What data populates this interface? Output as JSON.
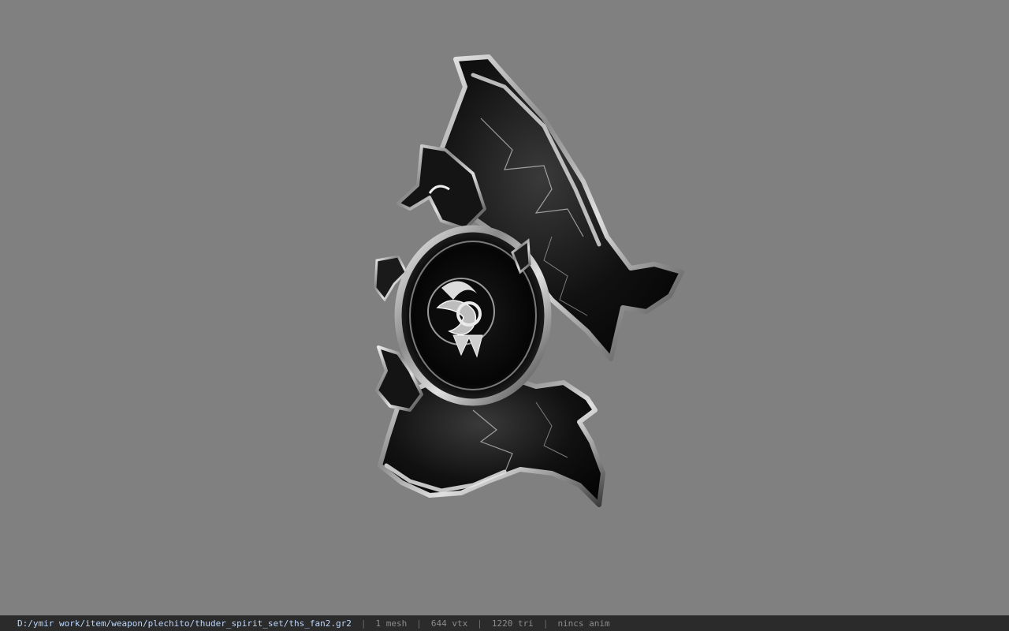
{
  "viewer": {
    "background_color": "#808080",
    "model_icon": "fan-weapon-model"
  },
  "status_bar": {
    "file_path": "D:/ymir work/item/weapon/plechito/thuder_spirit_set/ths_fan2.gr2",
    "mesh_count": "1 mesh",
    "vertex_count": "644 vtx",
    "triangle_count": "1220 tri",
    "anim_status": "nincs anim",
    "separator": "|",
    "path_color": "#bcd7ff",
    "text_color": "#8c8c8c"
  }
}
